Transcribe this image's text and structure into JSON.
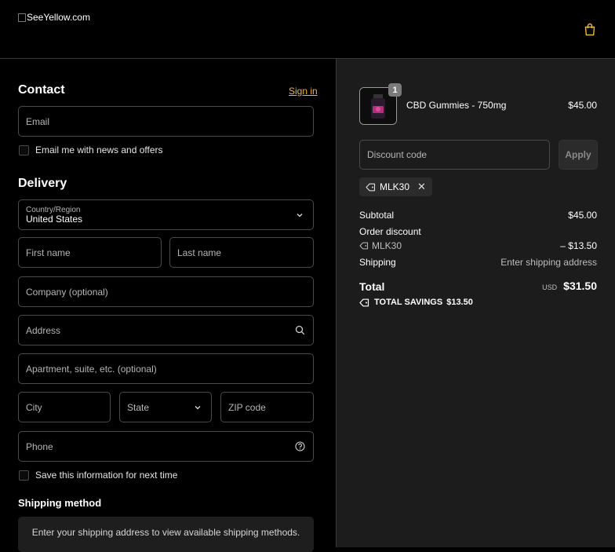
{
  "header": {
    "logo_alt": "SeeYellow.com",
    "cart_icon": "shopping-bag-icon"
  },
  "contact": {
    "heading": "Contact",
    "sign_in": "Sign in",
    "email_placeholder": "Email",
    "news_label": "Email me with news and offers"
  },
  "delivery": {
    "heading": "Delivery",
    "country_label": "Country/Region",
    "country_value": "United States",
    "first_name": "First name",
    "last_name": "Last name",
    "company": "Company (optional)",
    "address": "Address",
    "apartment": "Apartment, suite, etc. (optional)",
    "city": "City",
    "state": "State",
    "zip": "ZIP code",
    "phone": "Phone",
    "save_label": "Save this information for next time"
  },
  "shipping_method": {
    "heading": "Shipping method",
    "note": "Enter your shipping address to view available shipping methods."
  },
  "summary": {
    "product": {
      "name": "CBD Gummies - 750mg",
      "price": "$45.00",
      "quantity": "1"
    },
    "discount_placeholder": "Discount code",
    "apply_label": "Apply",
    "applied_code": "MLK30",
    "subtotal_label": "Subtotal",
    "subtotal_value": "$45.00",
    "order_discount_label": "Order discount",
    "discount_code": "MLK30",
    "discount_value": "– $13.50",
    "shipping_label": "Shipping",
    "shipping_value": "Enter shipping address",
    "total_label": "Total",
    "currency": "USD",
    "total_value": "$31.50",
    "savings_label": "TOTAL SAVINGS",
    "savings_value": "$13.50"
  },
  "colors": {
    "accent_link": "#e8b64c",
    "summary_bg": "#1c1c1c",
    "page_bg": "#000000"
  }
}
